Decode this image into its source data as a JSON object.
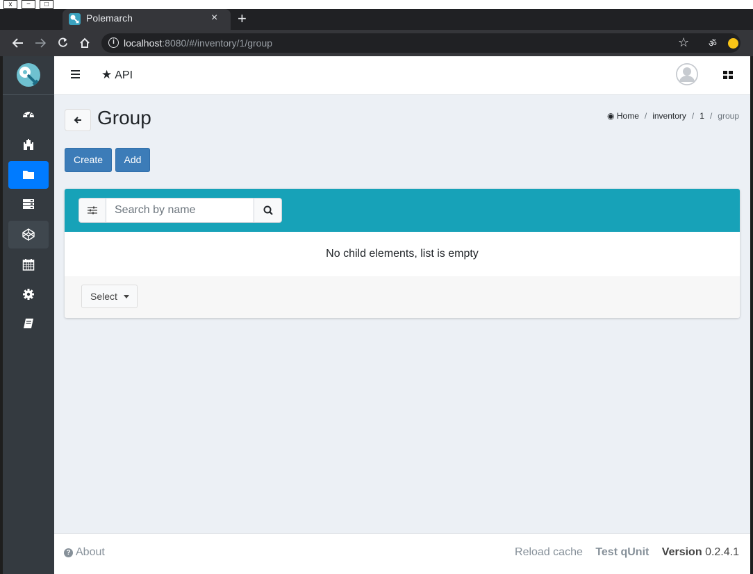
{
  "browser": {
    "window_controls": [
      "x",
      "−",
      "□"
    ],
    "tab_title": "Polemarch",
    "tab_close": "×",
    "new_tab": "+",
    "url_host": "localhost",
    "url_rest": ":8080/#/inventory/1/group",
    "icons": [
      "back-arrow-icon",
      "forward-arrow-icon",
      "reload-icon",
      "home-icon",
      "info-icon",
      "star-icon",
      "incognito-icon",
      "extension-icon"
    ]
  },
  "sidebar": {
    "items": [
      {
        "icon": "dashboard-icon"
      },
      {
        "icon": "castle-icon"
      },
      {
        "icon": "folder-icon",
        "active": true
      },
      {
        "icon": "server-icon"
      },
      {
        "icon": "codepen-icon"
      },
      {
        "icon": "calendar-icon"
      },
      {
        "icon": "cog-icon"
      },
      {
        "icon": "book-icon"
      }
    ]
  },
  "navbar": {
    "api_label": "API"
  },
  "page": {
    "title": "Group",
    "breadcrumb": [
      "Home",
      "inventory",
      "1",
      "group"
    ]
  },
  "actions": {
    "create_label": "Create",
    "add_label": "Add"
  },
  "search": {
    "placeholder": "Search by name"
  },
  "list": {
    "empty_message": "No child elements, list is empty",
    "select_label": "Select"
  },
  "footer": {
    "about": "About",
    "reload_cache": "Reload cache",
    "test_qunit": "Test qUnit",
    "version_label": "Version",
    "version_number": "0.2.4.1"
  },
  "colors": {
    "sidebar_bg": "#343a40",
    "active_item": "#007bff",
    "card_header": "#17a2b8",
    "primary_button": "#3c7cb8",
    "content_bg": "#ecf0f5"
  }
}
